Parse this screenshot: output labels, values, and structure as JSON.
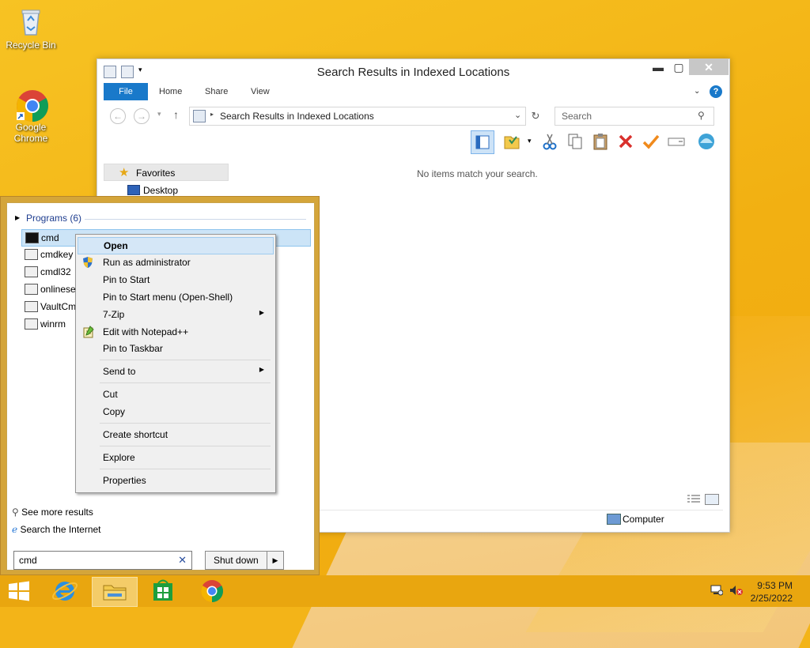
{
  "desktop": {
    "recycle_bin_label": "Recycle Bin",
    "chrome_label": "Google Chrome"
  },
  "explorer": {
    "title": "Search Results in Indexed Locations",
    "ribbon_tabs": [
      "File",
      "Home",
      "Share",
      "View"
    ],
    "address_path": "Search Results in Indexed Locations",
    "search_placeholder": "Search",
    "favorites_label": "Favorites",
    "desktop_label": "Desktop",
    "empty_message": "No items match your search.",
    "status_location": "Computer"
  },
  "start_menu": {
    "group_label": "Programs (6)",
    "items": [
      "cmd",
      "cmdkey",
      "cmdl32",
      "onlineset",
      "VaultCm",
      "winrm"
    ],
    "see_more": "See more results",
    "search_internet": "Search the Internet",
    "search_value": "cmd",
    "shutdown_label": "Shut down"
  },
  "context_menu": {
    "items": [
      "Open",
      "Run as administrator",
      "Pin to Start",
      "Pin to Start menu (Open-Shell)",
      "7-Zip",
      "Edit with Notepad++",
      "Pin to Taskbar",
      "Send to",
      "Cut",
      "Copy",
      "Create shortcut",
      "Explore",
      "Properties"
    ]
  },
  "taskbar": {
    "time": "9:53 PM",
    "date": "2/25/2022"
  },
  "colors": {
    "accent_blue": "#1979ca",
    "desktop_orange": "#f3b418",
    "start_menu_frame": "#d4a53a"
  }
}
